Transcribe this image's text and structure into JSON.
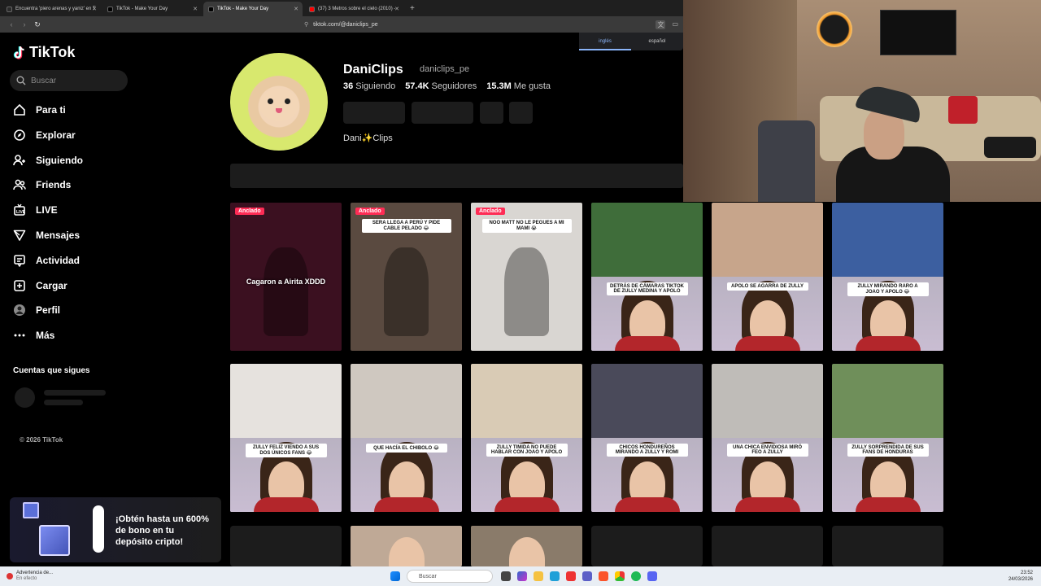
{
  "browser": {
    "tabs": [
      {
        "title": "Encuentra 'piero arenas y yaniz' en T",
        "active": false,
        "favicon_color": "#2a2a2a"
      },
      {
        "title": "TikTok - Make Your Day",
        "active": false,
        "favicon_color": "#000000"
      },
      {
        "title": "TikTok - Make Your Day",
        "active": true,
        "favicon_color": "#000000"
      },
      {
        "title": "(37) 3 Metros sobre el cielo (2010) -",
        "active": false,
        "favicon_color": "#ff0000"
      }
    ],
    "new_tab": "+",
    "url": "tiktok.com/@daniclips_pe"
  },
  "translate_popup": {
    "lang_1": "inglés",
    "lang_2": "español"
  },
  "sidebar": {
    "logo": "TikTok",
    "search_placeholder": "Buscar",
    "items": [
      {
        "label": "Para ti",
        "icon": "home-icon"
      },
      {
        "label": "Explorar",
        "icon": "compass-icon"
      },
      {
        "label": "Siguiendo",
        "icon": "following-icon"
      },
      {
        "label": "Friends",
        "icon": "friends-icon"
      },
      {
        "label": "LIVE",
        "icon": "live-icon"
      },
      {
        "label": "Mensajes",
        "icon": "messages-icon"
      },
      {
        "label": "Actividad",
        "icon": "activity-icon"
      },
      {
        "label": "Cargar",
        "icon": "upload-icon"
      },
      {
        "label": "Perfil",
        "icon": "profile-icon"
      },
      {
        "label": "Más",
        "icon": "more-icon"
      }
    ],
    "following_title": "Cuentas que sigues",
    "copyright": "© 2026 TikTok"
  },
  "promo": {
    "text": "¡Obtén hasta un 600% de bono en tu depósito cripto!"
  },
  "profile": {
    "display_name": "DaniClips",
    "handle": "daniclips_pe",
    "stats": [
      {
        "value": "36",
        "label": "Siguiendo"
      },
      {
        "value": "57.4K",
        "label": "Seguidores"
      },
      {
        "value": "15.3M",
        "label": "Me gusta"
      }
    ],
    "bio": "Dani✨Clips"
  },
  "pinned_label": "Anclado",
  "videos": [
    {
      "pinned": true,
      "caption": "Cagaron a Airita XDDD",
      "style": "overlay",
      "bg": "#3b1020"
    },
    {
      "pinned": true,
      "caption": "SERA LLEGA A PERÚ Y PIDE CABLE PELADO 😂",
      "style": "white",
      "bg": "#5a4a40"
    },
    {
      "pinned": true,
      "caption": "NOO MATT NO LE PEGUES A MI MAMI 😭",
      "style": "white",
      "bg": "#d9d6d2"
    },
    {
      "pinned": false,
      "caption": "DETRÁS DE CÁMARAS TIKTOK DE ZULLY MEDINA Y APOLO",
      "style": "white",
      "bg": "#3f6d3a"
    },
    {
      "pinned": false,
      "caption": "APOLO SE AGARRA DE ZULLY",
      "style": "white",
      "bg": "#c7a58b"
    },
    {
      "pinned": false,
      "caption": "ZULLY MIRANDO RARO A JOAO Y APOLO 😂",
      "style": "white",
      "bg": "#3c5fa0"
    },
    {
      "pinned": false,
      "caption": "ZULLY FELIZ VIENDO A SUS DOS ÚNICOS FANS 😂",
      "style": "white",
      "bg": "#e6e2de"
    },
    {
      "pinned": false,
      "caption": "QUE HACÍA EL CHIBOLO 😂",
      "style": "white",
      "bg": "#cfc8c0"
    },
    {
      "pinned": false,
      "caption": "ZULLY TIMIDA NO PUEDE HABLAR CON JOAO Y APOLO",
      "style": "white",
      "bg": "#d9cbb5"
    },
    {
      "pinned": false,
      "caption": "CHICOS HONDUREÑOS MIRANDO A ZULLY Y ROMI",
      "style": "white",
      "bg": "#4a4a5a"
    },
    {
      "pinned": false,
      "caption": "UNA CHICA ENVIDIOSA MIRÓ FEO A ZULLY",
      "style": "white",
      "bg": "#bfbcb8"
    },
    {
      "pinned": false,
      "caption": "ZULLY SORPRENDIDA DE SUS FANS DE HONDURAS",
      "style": "white",
      "bg": "#6f8f5a"
    }
  ],
  "taskbar": {
    "alert_title": "Advertencia de...",
    "alert_sub": "En efecto",
    "search": "Buscar",
    "time": "23:52",
    "date": "24/03/2026"
  }
}
